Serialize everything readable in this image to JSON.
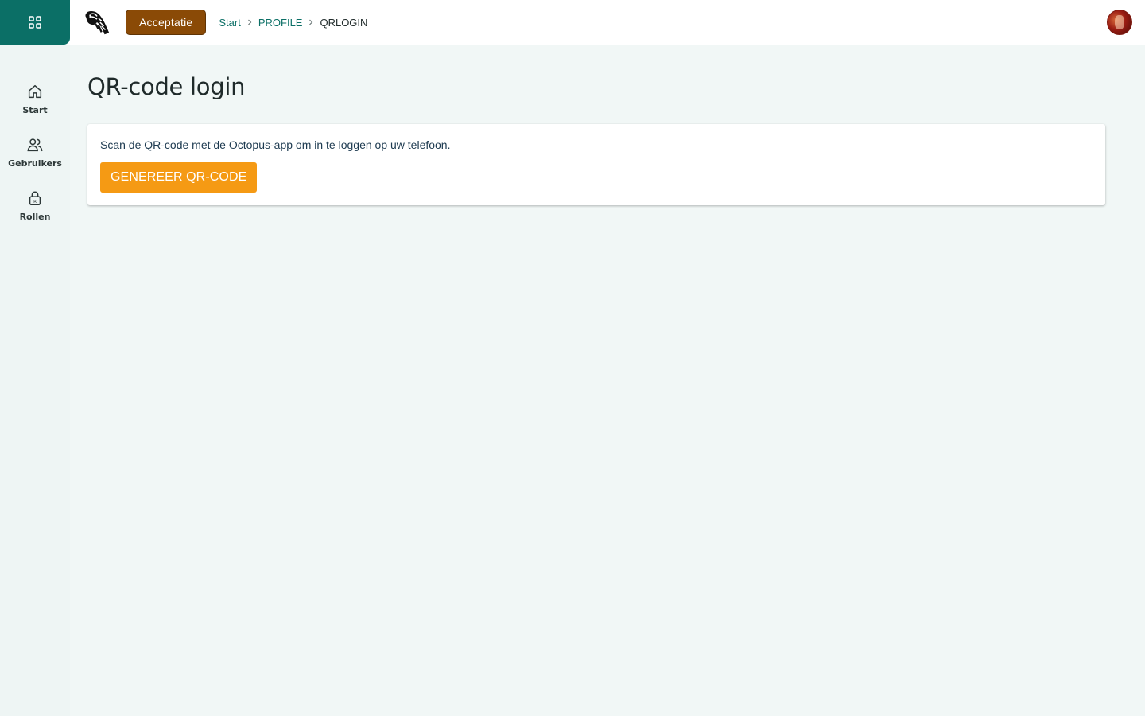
{
  "topbar": {
    "launcher_icon": "grid-icon",
    "logo_icon": "zebra-logo-icon",
    "environment_badge": "Acceptatie",
    "breadcrumb": [
      {
        "label": "Start",
        "link": true
      },
      {
        "label": "PROFILE",
        "link": true
      },
      {
        "label": "QRLOGIN",
        "link": false
      }
    ],
    "avatar_icon": "user-avatar"
  },
  "sidebar": {
    "items": [
      {
        "label": "Start",
        "icon": "home-icon"
      },
      {
        "label": "Gebruikers",
        "icon": "users-icon"
      },
      {
        "label": "Rollen",
        "icon": "lock-icon"
      }
    ]
  },
  "main": {
    "title": "QR-code login",
    "card": {
      "text": "Scan de QR-code met de Octopus-app om in te loggen op uw telefoon.",
      "button_label": "GENEREER QR-CODE"
    }
  },
  "colors": {
    "brand_teal": "#0b6f66",
    "env_badge": "#8a4a06",
    "primary_button": "#f59a14",
    "page_background": "#f1f7f6"
  }
}
